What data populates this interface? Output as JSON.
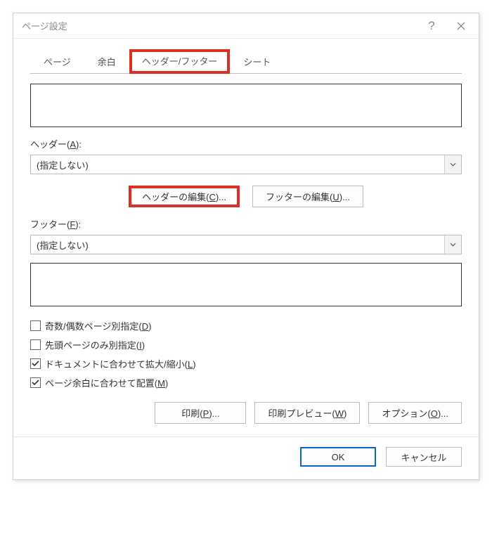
{
  "titlebar": {
    "title": "ページ設定"
  },
  "tabs": {
    "page": "ページ",
    "margins": "余白",
    "header_footer": "ヘッダー/フッター",
    "sheet": "シート"
  },
  "header": {
    "label_pre": "ヘッダー(",
    "label_key": "A",
    "label_post": "):",
    "value": "(指定しない)"
  },
  "buttons": {
    "edit_header_pre": "ヘッダーの編集(",
    "edit_header_key": "C",
    "edit_header_post": ")...",
    "edit_footer_pre": "フッターの編集(",
    "edit_footer_key": "U",
    "edit_footer_post": ")..."
  },
  "footer_field": {
    "label_pre": "フッター(",
    "label_key": "F",
    "label_post": "):",
    "value": "(指定しない)"
  },
  "checkboxes": {
    "odd_even_pre": "奇数/偶数ページ別指定(",
    "odd_even_key": "D",
    "odd_even_post": ")",
    "first_page_pre": "先頭ページのみ別指定(",
    "first_page_key": "I",
    "first_page_post": ")",
    "scale_doc_pre": "ドキュメントに合わせて拡大/縮小(",
    "scale_doc_key": "L",
    "scale_doc_post": ")",
    "align_margins_pre": "ページ余白に合わせて配置(",
    "align_margins_key": "M",
    "align_margins_post": ")"
  },
  "bottom": {
    "print_pre": "印刷(",
    "print_key": "P",
    "print_post": ")...",
    "preview_pre": "印刷プレビュー(",
    "preview_key": "W",
    "preview_post": ")",
    "options_pre": "オプション(",
    "options_key": "O",
    "options_post": ")..."
  },
  "footer": {
    "ok": "OK",
    "cancel": "キャンセル"
  }
}
